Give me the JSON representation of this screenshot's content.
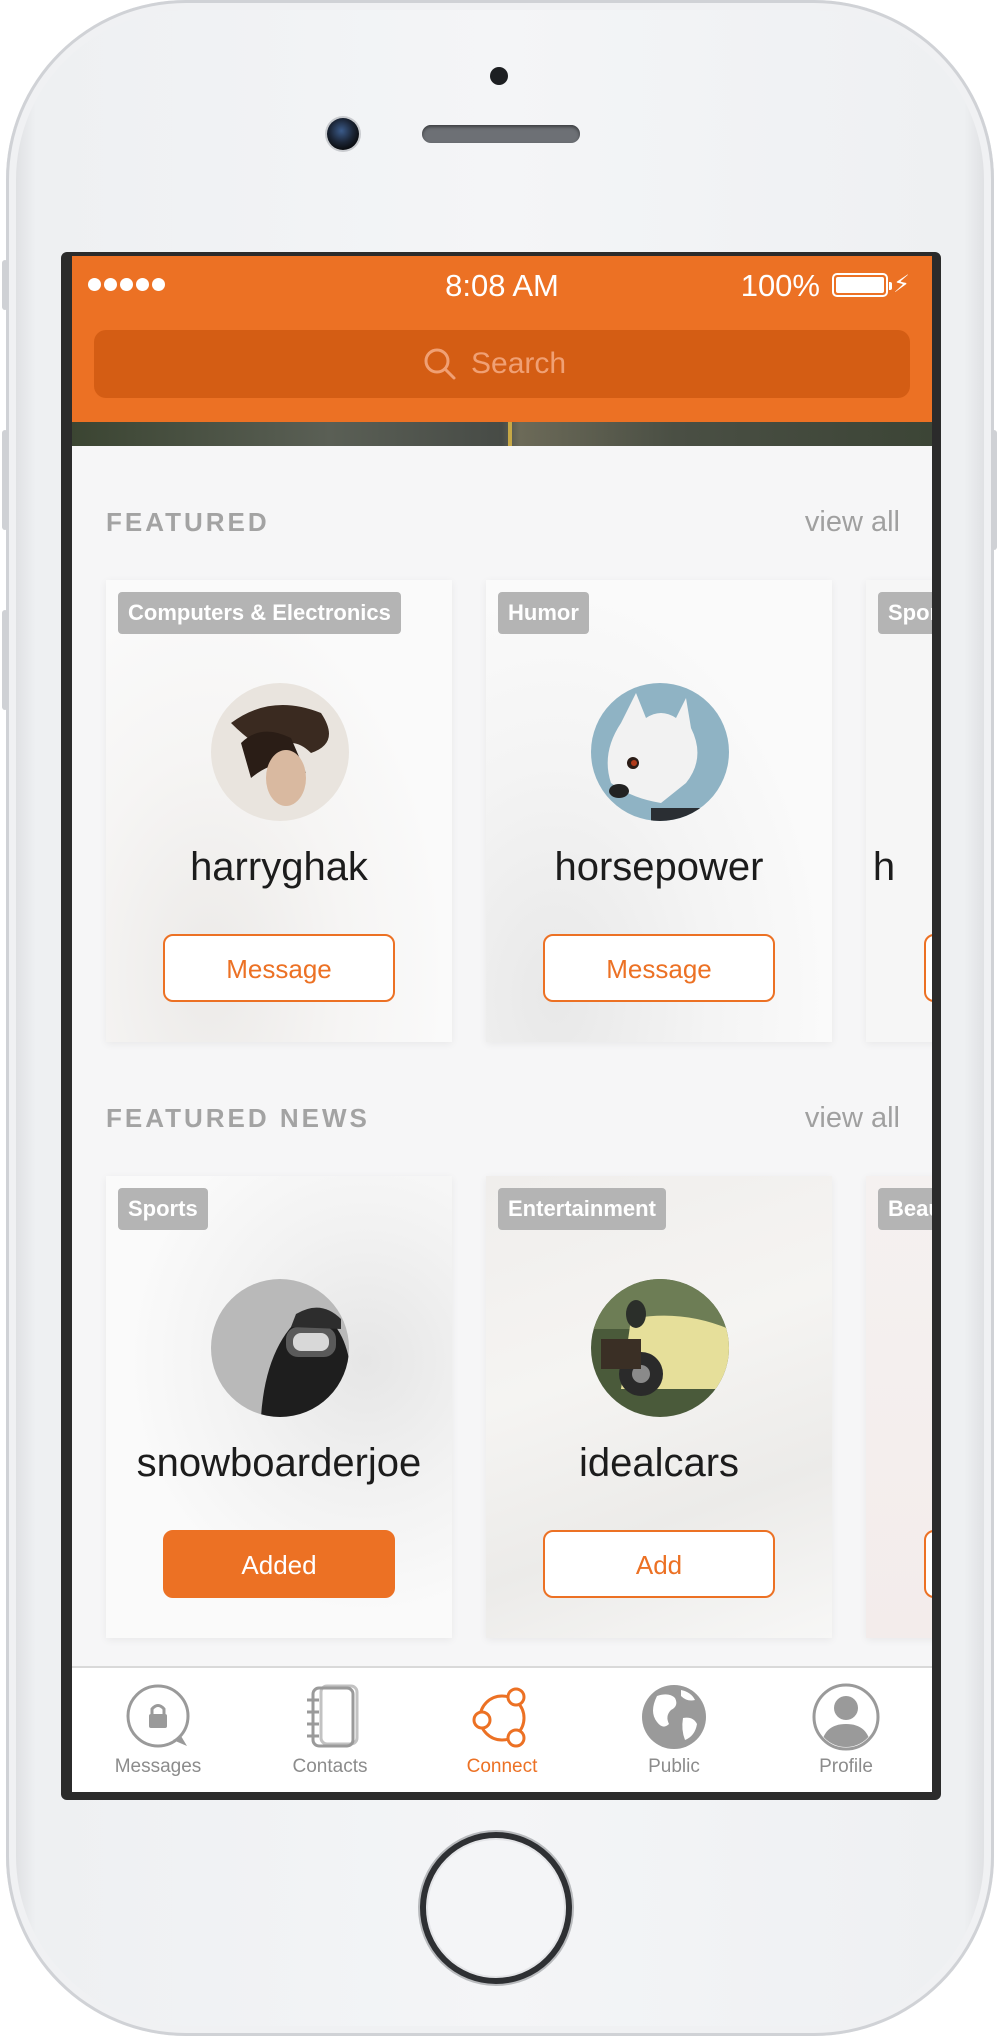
{
  "status_bar": {
    "time": "8:08 AM",
    "battery": "100%"
  },
  "search": {
    "placeholder": "Search"
  },
  "featured": {
    "title": "FEATURED",
    "view_all": "view all",
    "cards": [
      {
        "tag": "Computers & Electronics",
        "username": "harryghak",
        "button": "Message"
      },
      {
        "tag": "Humor",
        "username": "horsepower",
        "button": "Message"
      },
      {
        "tag": "Spor",
        "username": "h"
      }
    ]
  },
  "featured_news": {
    "title": "FEATURED NEWS",
    "view_all": "view all",
    "cards": [
      {
        "tag": "Sports",
        "username": "snowboarderjoe",
        "button": "Added"
      },
      {
        "tag": "Entertainment",
        "username": "idealcars",
        "button": "Add"
      },
      {
        "tag": "Beau"
      }
    ]
  },
  "tabs": [
    {
      "label": "Messages",
      "icon": "lock-chat-icon"
    },
    {
      "label": "Contacts",
      "icon": "notebook-icon"
    },
    {
      "label": "Connect",
      "icon": "connect-icon",
      "active": true
    },
    {
      "label": "Public",
      "icon": "globe-icon"
    },
    {
      "label": "Profile",
      "icon": "person-icon"
    }
  ],
  "colors": {
    "accent": "#ec7124",
    "search_bg": "#d45d14",
    "tag_bg": "#b4b4b4"
  }
}
